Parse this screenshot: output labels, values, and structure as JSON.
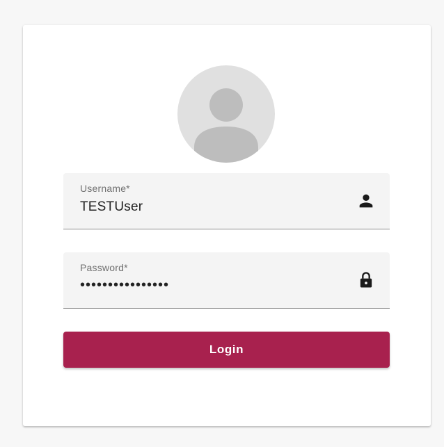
{
  "login_form": {
    "avatar_icon": "account-circle-icon",
    "username": {
      "label": "Username*",
      "value": "TESTUser",
      "icon": "person-icon"
    },
    "password": {
      "label": "Password*",
      "value": "••••••••••••••••",
      "icon": "lock-icon"
    },
    "login_button_label": "Login"
  },
  "colors": {
    "accent": "#a8214e",
    "field_background": "#f4f4f4",
    "avatar_background": "#e0e0e0",
    "page_background": "#f7f7f7"
  }
}
